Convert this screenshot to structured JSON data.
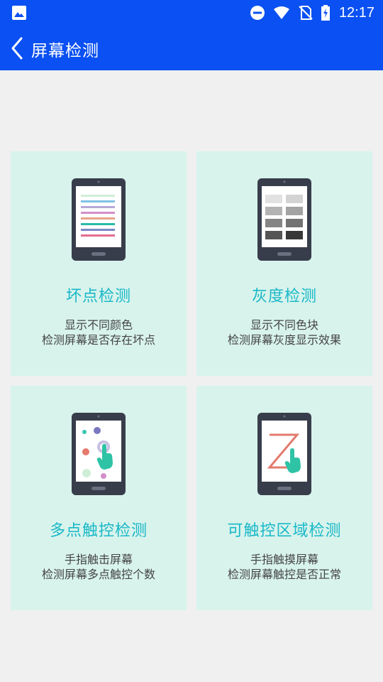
{
  "status_bar": {
    "time": "12:17",
    "icons": [
      "image-icon",
      "do-not-disturb-icon",
      "wifi-icon",
      "no-sim-icon",
      "battery-charging-icon"
    ]
  },
  "app_bar": {
    "back_icon": "chevron-left-icon",
    "title": "屏幕检测"
  },
  "cards": [
    {
      "title": "坏点检测",
      "line1": "显示不同颜色",
      "line2": "检测屏幕是否存在坏点",
      "illustration": "phone-color-lines-icon"
    },
    {
      "title": "灰度检测",
      "line1": "显示不同色块",
      "line2": "检测屏幕灰度显示效果",
      "illustration": "phone-gray-blocks-icon"
    },
    {
      "title": "多点触控检测",
      "line1": "手指触击屏幕",
      "line2": "检测屏幕多点触控个数",
      "illustration": "phone-multitouch-icon"
    },
    {
      "title": "可触控区域检测",
      "line1": "手指触摸屏幕",
      "line2": "检测屏幕触控是否正常",
      "illustration": "phone-touch-area-icon"
    }
  ],
  "colors": {
    "primary": "#0a50f2",
    "card_bg": "#d8f3ec",
    "title_text": "#19b8c7",
    "desc_text": "#444444",
    "page_bg": "#f0f0f0"
  }
}
